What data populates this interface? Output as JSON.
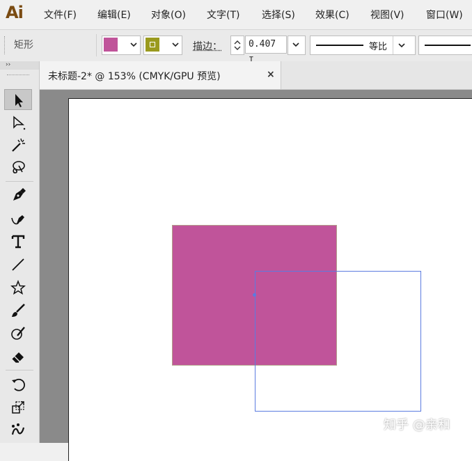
{
  "app": {
    "logo": "Ai"
  },
  "menu": [
    "文件(F)",
    "编辑(E)",
    "对象(O)",
    "文字(T)",
    "选择(S)",
    "效果(C)",
    "视图(V)",
    "窗口(W)"
  ],
  "control_bar": {
    "shape_label": "矩形",
    "fill_color": "#c0549a",
    "stroke_color": "#9a9a1e",
    "stroke_label": "描边：",
    "stroke_value": "0.407 ",
    "stroke_unit_truncated": "I",
    "profile_label": "等比"
  },
  "document_tab": {
    "title": "未标题-2* @ 153% (CMYK/GPU 预览)",
    "close": "×"
  },
  "toolbar": {
    "collapse": "››",
    "tools": [
      "selection-tool",
      "direct-selection-tool",
      "magic-wand-tool",
      "lasso-tool",
      "pen-tool",
      "curvature-tool",
      "type-tool",
      "line-segment-tool",
      "star-tool",
      "paintbrush-tool",
      "shaper-tool",
      "eraser-tool",
      "rotate-tool",
      "scale-tool",
      "puppet-warp-tool"
    ]
  },
  "canvas": {
    "filled_rect_color": "#c0549a",
    "outline_rect_color": "#5b7be0"
  },
  "watermark": "知乎 @亲和"
}
